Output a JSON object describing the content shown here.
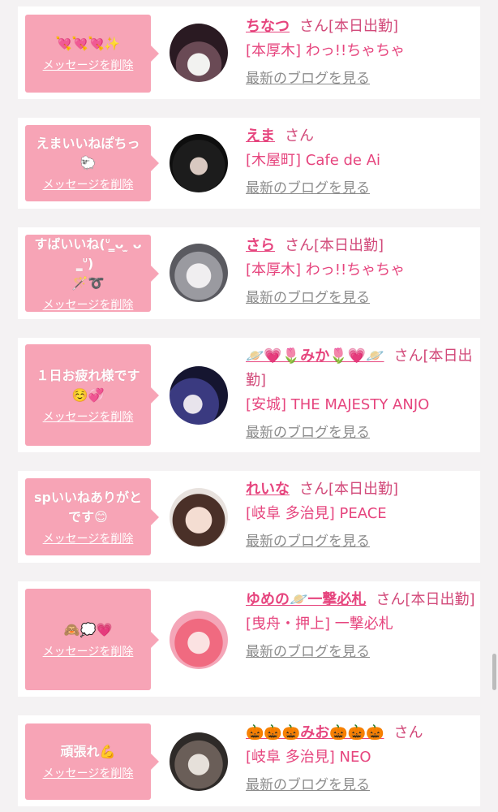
{
  "delete_label": "メッセージを削除",
  "blog_label": "最新のブログを見る",
  "san": "さん",
  "colors": {
    "bubble": "#f7a4b6",
    "name": "#e6457e",
    "blog": "#8c8c8c"
  },
  "cards": [
    {
      "message": "💘💘💘✨",
      "name": "ちなつ",
      "status": "[本日出勤]",
      "shop": "[本厚木] わっ!!ちゃちゃ"
    },
    {
      "message": "えまいいねぽちっ\n🐑",
      "name": "えま",
      "status": "",
      "shop": "[木屋町] Cafe de Ai"
    },
    {
      "message": "すばいいね(ᐡ ̳ᴗ ̫ ᴗ ̳ᐡ)\n🪄➰",
      "name": "さら",
      "status": "[本日出勤]",
      "shop": "[本厚木] わっ!!ちゃちゃ"
    },
    {
      "message": "１日お疲れ様です\n☺️💞",
      "name": "🪐💗🌷みか🌷💗🪐",
      "status": "[本日出勤]",
      "shop": "[安城] THE MAJESTY ANJO"
    },
    {
      "message": "spいいねありがと\nです😊",
      "name": "れいな",
      "status": "[本日出勤]",
      "shop": "[岐阜 多治見] PEACE"
    },
    {
      "message": "🙈💭💗",
      "name": "ゆめの🪐一撃必札",
      "status": "[本日出勤]",
      "shop": "[曳舟・押上] 一撃必札"
    },
    {
      "message": "頑張れ💪",
      "name": "🎃🎃🎃みお🎃🎃🎃",
      "status": "",
      "shop": "[岐阜 多治見] NEO"
    }
  ]
}
